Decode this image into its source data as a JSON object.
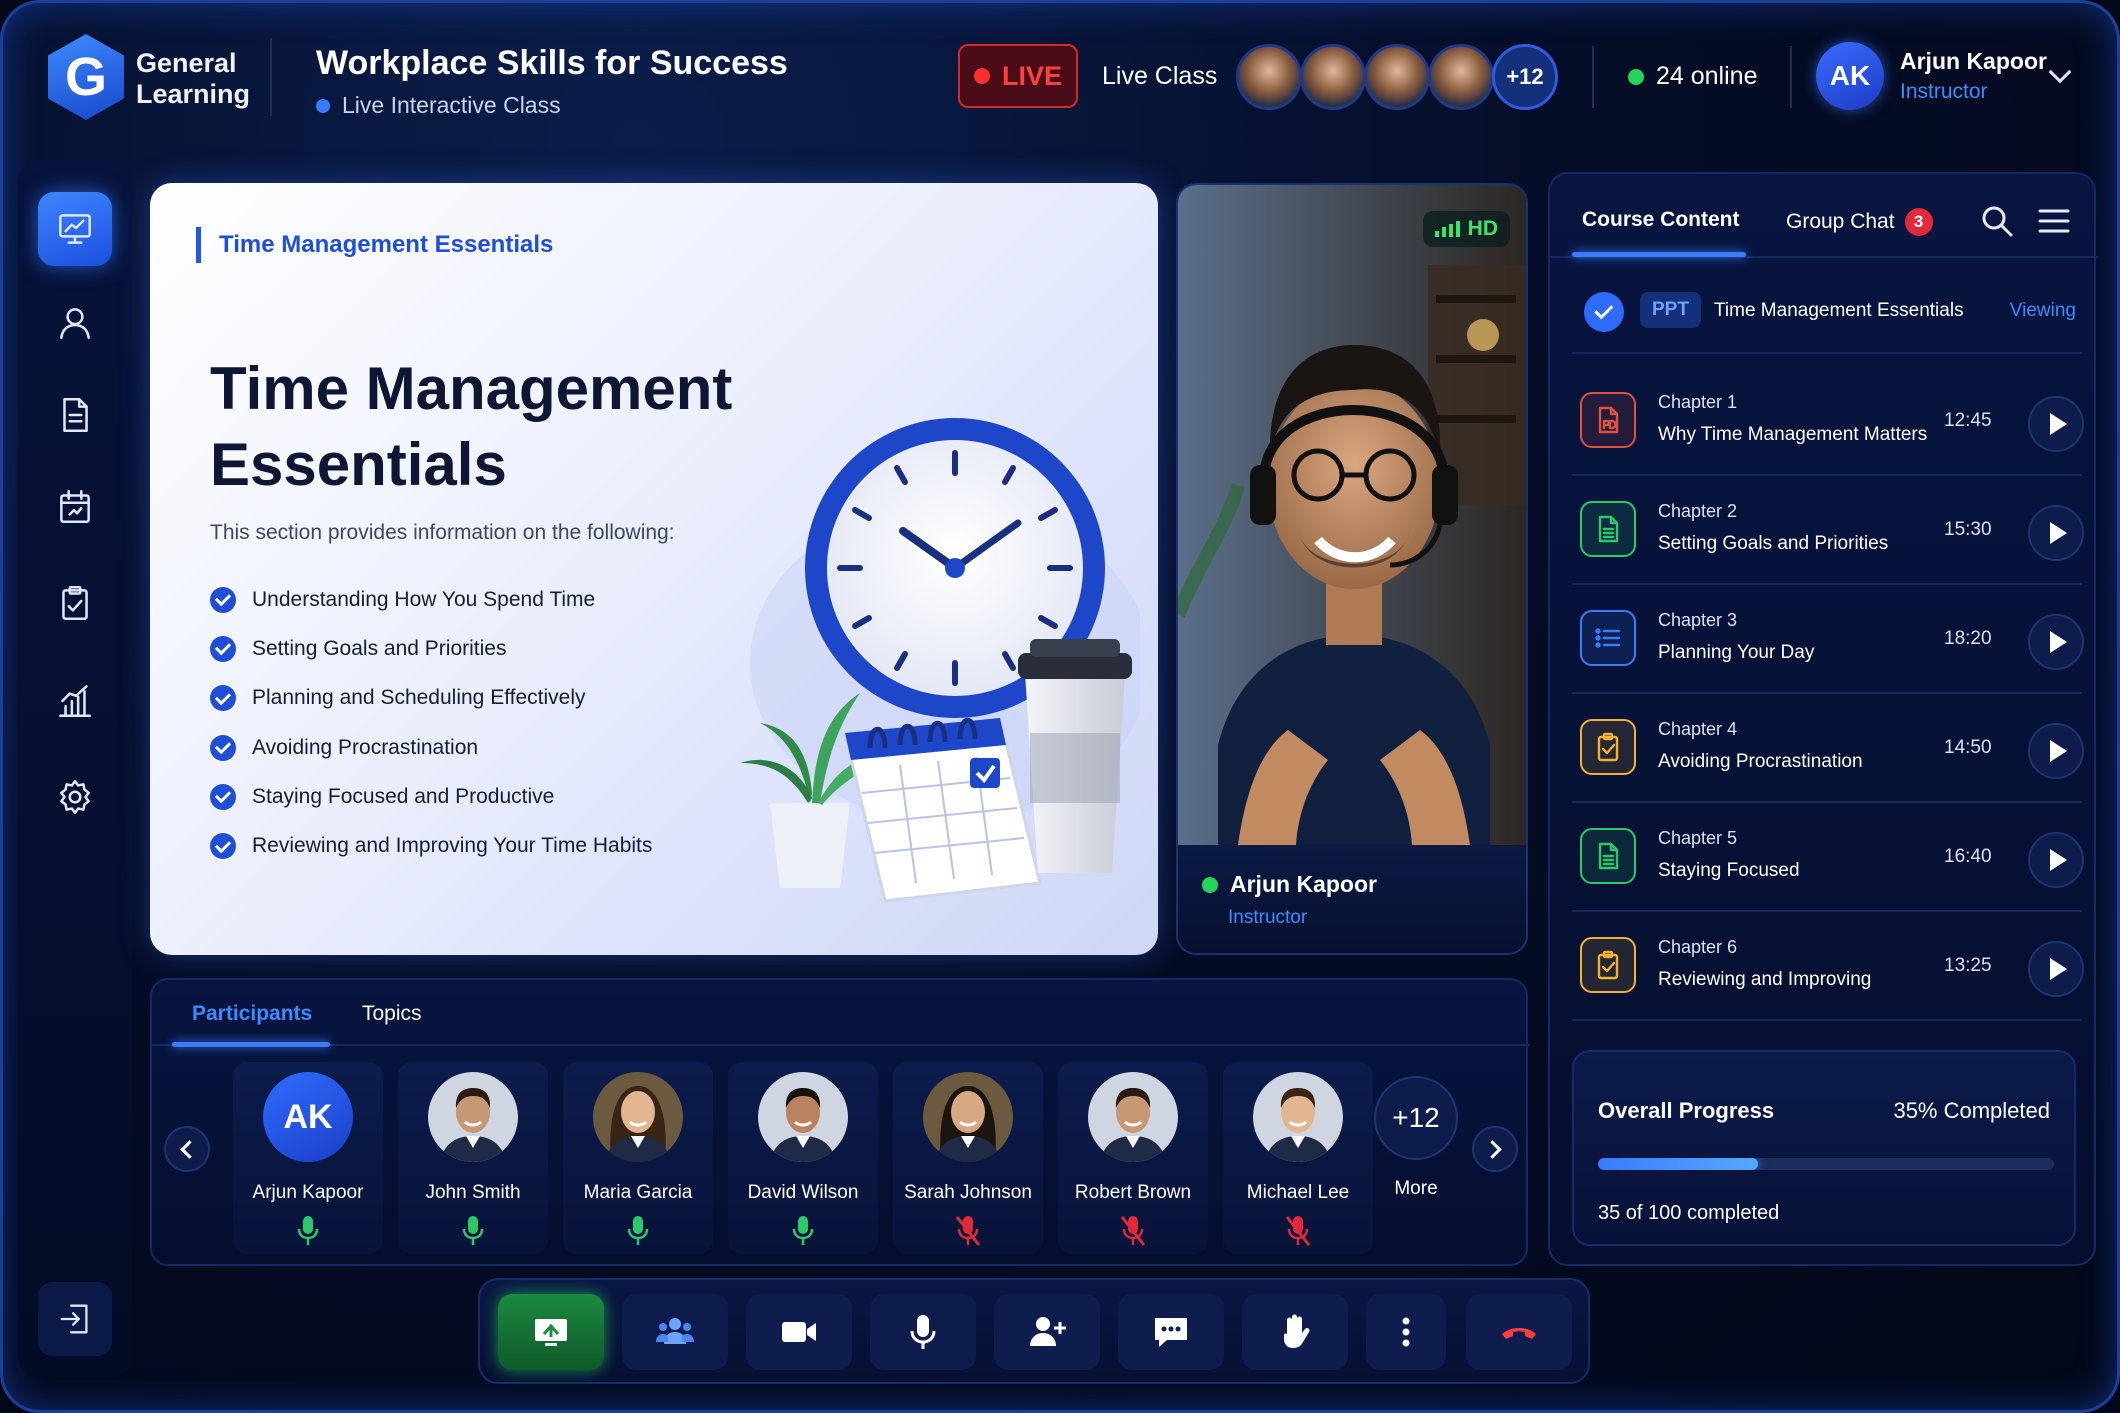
{
  "header": {
    "brand": "General Learning",
    "brand_line1": "General",
    "brand_line2": "Learning",
    "logo_letter": "G",
    "course_title": "Workplace Skills for Success",
    "course_subtitle": "Live Interactive Class",
    "live_label": "LIVE",
    "live_class_label": "Live Class",
    "extra_viewers": "+12",
    "online_count": "24 online",
    "user": {
      "initials": "AK",
      "name": "Arjun Kapoor",
      "role": "Instructor"
    }
  },
  "sidebar": {
    "items": [
      {
        "name": "presentation",
        "icon": "presentation-icon",
        "active": true
      },
      {
        "name": "profile",
        "icon": "user-icon"
      },
      {
        "name": "documents",
        "icon": "document-icon"
      },
      {
        "name": "calendar",
        "icon": "calendar-icon"
      },
      {
        "name": "assignments",
        "icon": "clipboard-check-icon"
      },
      {
        "name": "analytics",
        "icon": "bar-chart-icon"
      },
      {
        "name": "settings",
        "icon": "gear-icon"
      }
    ],
    "exit_icon": "exit-icon"
  },
  "slide": {
    "tag": "Time Management Essentials",
    "title": "Time Management Essentials",
    "intro": "This section provides information on the following:",
    "points": [
      "Understanding How You Spend Time",
      "Setting Goals and Priorities",
      "Planning and Scheduling Effectively",
      "Avoiding Procrastination",
      "Staying Focused and Productive",
      "Reviewing and Improving Your Time Habits"
    ]
  },
  "video": {
    "quality": "HD",
    "name": "Arjun Kapoor",
    "role": "Instructor"
  },
  "panel": {
    "tabs": [
      {
        "label": "Course Content",
        "active": true
      },
      {
        "label": "Group Chat",
        "badge": "3"
      }
    ],
    "current": {
      "type": "PPT",
      "title": "Time Management Essentials",
      "status": "Viewing"
    },
    "chapters": [
      {
        "num": "Chapter 1",
        "title": "Why Time Management Matters",
        "duration": "12:45",
        "icon": "pdf-icon",
        "color": "#e2503f"
      },
      {
        "num": "Chapter 2",
        "title": "Setting Goals and Priorities",
        "duration": "15:30",
        "icon": "doc-icon",
        "color": "#2ec76a"
      },
      {
        "num": "Chapter 3",
        "title": "Planning Your Day",
        "duration": "18:20",
        "icon": "list-icon",
        "color": "#3b7cff"
      },
      {
        "num": "Chapter 4",
        "title": "Avoiding Procrastination",
        "duration": "14:50",
        "icon": "clipboard-icon",
        "color": "#f0b232"
      },
      {
        "num": "Chapter 5",
        "title": "Staying Focused",
        "duration": "16:40",
        "icon": "doc-icon",
        "color": "#2ec76a"
      },
      {
        "num": "Chapter 6",
        "title": "Reviewing and Improving",
        "duration": "13:25",
        "icon": "clipboard-icon",
        "color": "#f0b232"
      }
    ],
    "progress": {
      "label": "Overall Progress",
      "percent_text": "35% Completed",
      "fraction": 0.35,
      "count_text": "35 of 100 completed"
    }
  },
  "participants": {
    "tabs": [
      {
        "label": "Participants",
        "active": true
      },
      {
        "label": "Topics"
      }
    ],
    "people": [
      {
        "name": "Arjun Kapoor",
        "initials": "AK",
        "mic": "on"
      },
      {
        "name": "John Smith",
        "mic": "on"
      },
      {
        "name": "Maria Garcia",
        "mic": "on"
      },
      {
        "name": "David Wilson",
        "mic": "on"
      },
      {
        "name": "Sarah Johnson",
        "mic": "off"
      },
      {
        "name": "Robert Brown",
        "mic": "off"
      },
      {
        "name": "Michael Lee",
        "mic": "off"
      }
    ],
    "more_count": "+12",
    "more_label": "More"
  },
  "controls": [
    {
      "name": "share-screen",
      "icon": "screen-share-icon"
    },
    {
      "name": "participants",
      "icon": "people-icon"
    },
    {
      "name": "camera",
      "icon": "video-camera-icon"
    },
    {
      "name": "microphone",
      "icon": "microphone-icon"
    },
    {
      "name": "add-user",
      "icon": "add-user-icon"
    },
    {
      "name": "chat",
      "icon": "chat-icon"
    },
    {
      "name": "raise-hand",
      "icon": "hand-icon"
    },
    {
      "name": "more",
      "icon": "more-vertical-icon"
    },
    {
      "name": "end-call",
      "icon": "end-call-icon"
    }
  ],
  "colors": {
    "accent": "#3a7bff",
    "live": "#ff4141",
    "online": "#27d35b",
    "mic_on": "#2ec76a",
    "mic_off": "#e02a3a"
  }
}
